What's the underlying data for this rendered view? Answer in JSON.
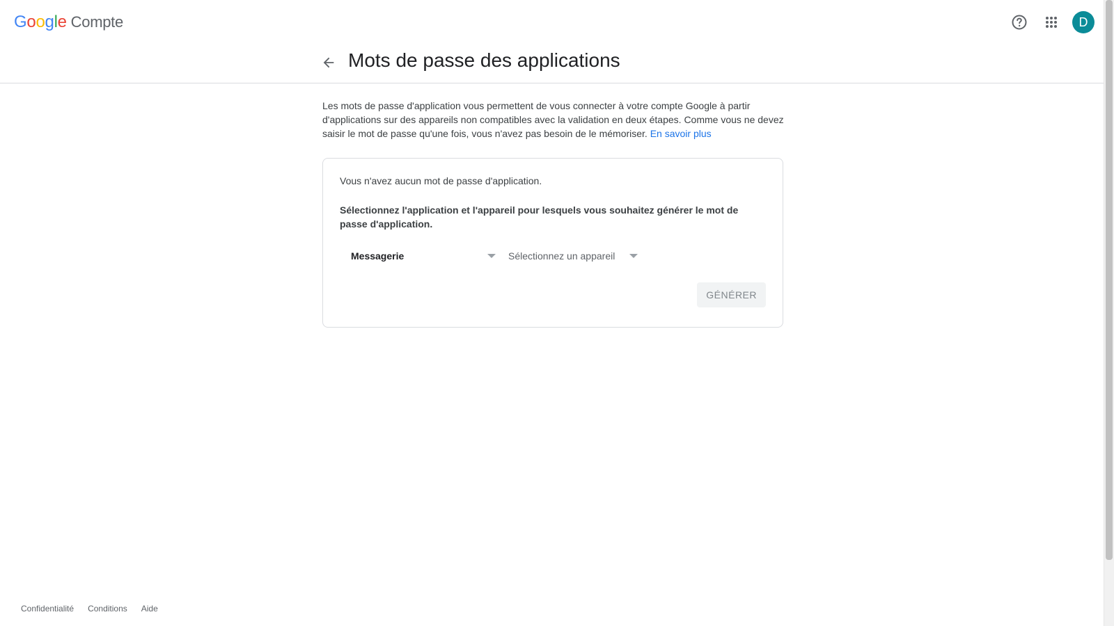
{
  "topbar": {
    "logo_letters": [
      {
        "char": "G",
        "color": "#4285f4"
      },
      {
        "char": "o",
        "color": "#ea4335"
      },
      {
        "char": "o",
        "color": "#fbbc05"
      },
      {
        "char": "g",
        "color": "#4285f4"
      },
      {
        "char": "l",
        "color": "#34a853"
      },
      {
        "char": "e",
        "color": "#ea4335"
      }
    ],
    "product_name": "Compte",
    "avatar_letter": "D",
    "avatar_color": "#0b8c98",
    "icons": [
      "help-icon",
      "apps-grid-icon"
    ]
  },
  "header": {
    "title": "Mots de passe des applications",
    "back_icon": "arrow-back-icon"
  },
  "main": {
    "description": "Les mots de passe d'application vous permettent de vous connecter à votre compte Google à partir d'applications sur des appareils non compatibles avec la validation en deux étapes. Comme vous ne devez saisir le mot de passe qu'une fois, vous n'avez pas besoin de le mémoriser.",
    "learn_more": "En savoir plus",
    "link_color": "#1a73e8",
    "card": {
      "empty_text": "Vous n'avez aucun mot de passe d'application.",
      "instructions": "Sélectionnez l'application et l'appareil pour lesquels vous souhaitez générer le mot de passe d'application.",
      "app_select_value": "Messagerie",
      "device_select_placeholder": "Sélectionnez un appareil",
      "generate_label": "GÉNÉRER"
    }
  },
  "footer": {
    "links": [
      "Confidentialité",
      "Conditions",
      "Aide"
    ]
  }
}
